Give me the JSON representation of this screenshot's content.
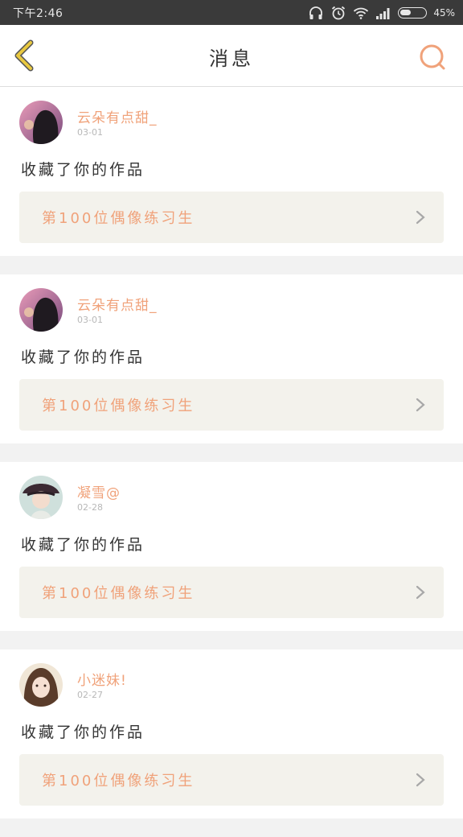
{
  "status_bar": {
    "time": "下午2:46",
    "battery_percent": "45%",
    "battery_level": 0.45
  },
  "header": {
    "title": "消息",
    "back_icon": "chevron-left-icon",
    "search_icon": "search-icon"
  },
  "colors": {
    "accent": "#f0a27a",
    "back_arrow": "#e8c840",
    "card_link_bg": "#f3f2ec"
  },
  "messages": [
    {
      "username": "云朵有点甜_",
      "date": "03-01",
      "action": "收藏了你的作品",
      "work_title": "第100位偶像练习生"
    },
    {
      "username": "云朵有点甜_",
      "date": "03-01",
      "action": "收藏了你的作品",
      "work_title": "第100位偶像练习生"
    },
    {
      "username": "凝雪@",
      "date": "02-28",
      "action": "收藏了你的作品",
      "work_title": "第100位偶像练习生"
    },
    {
      "username": "小迷妹!",
      "date": "02-27",
      "action": "收藏了你的作品",
      "work_title": "第100位偶像练习生"
    }
  ]
}
